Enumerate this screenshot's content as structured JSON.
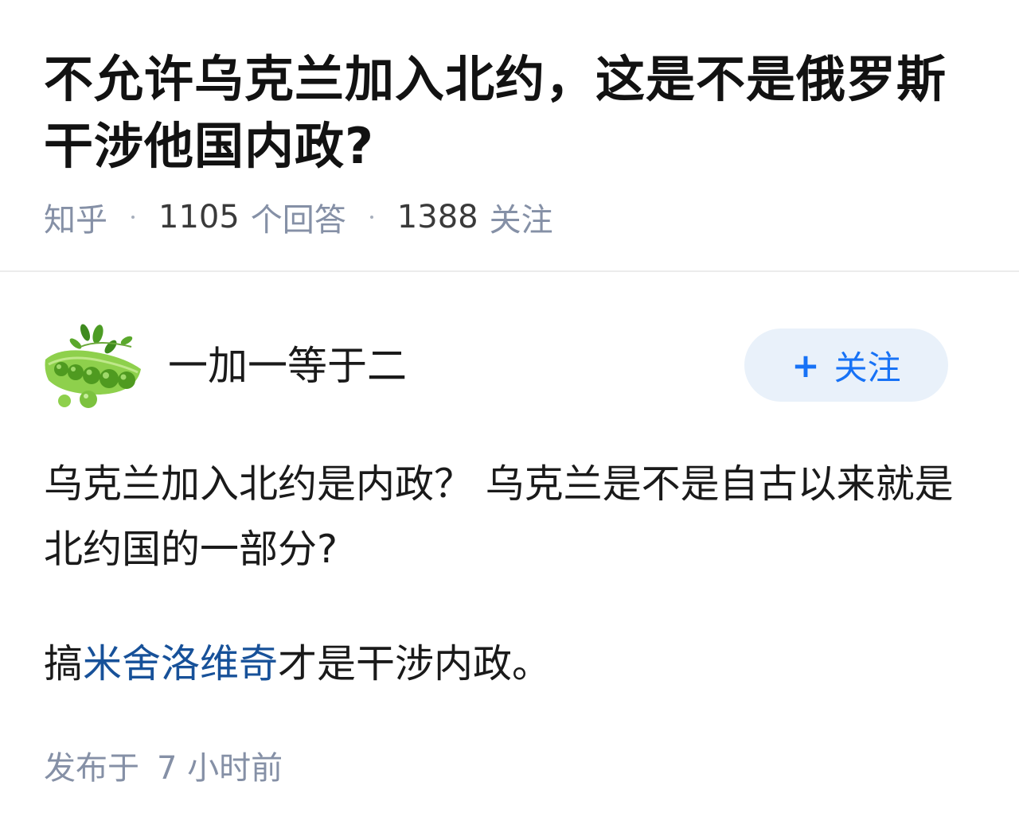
{
  "question": {
    "title": "不允许乌克兰加入北约，这是不是俄罗斯干涉他国内政?",
    "source": "知乎",
    "answers_count": "1105",
    "answers_label": "个回答",
    "followers_count": "1388",
    "followers_label": "关注"
  },
  "answer": {
    "author": {
      "name": "一加一等于二",
      "avatar_icon": "peapod-avatar-icon"
    },
    "follow_button": {
      "plus": "+",
      "label": "关注"
    },
    "paragraph1": "乌克兰加入北约是内政？ 乌克兰是不是自古以来就是北约国的一部分?",
    "paragraph2": {
      "before": "搞",
      "link": "米舍洛维奇",
      "after": "才是干涉内政。"
    },
    "published_prefix": "发布于",
    "published_time": "7 小时前"
  },
  "colors": {
    "link": "#175199",
    "follow_text": "#1772f6",
    "follow_bg": "#e9f1fa",
    "meta": "#8590a6"
  }
}
